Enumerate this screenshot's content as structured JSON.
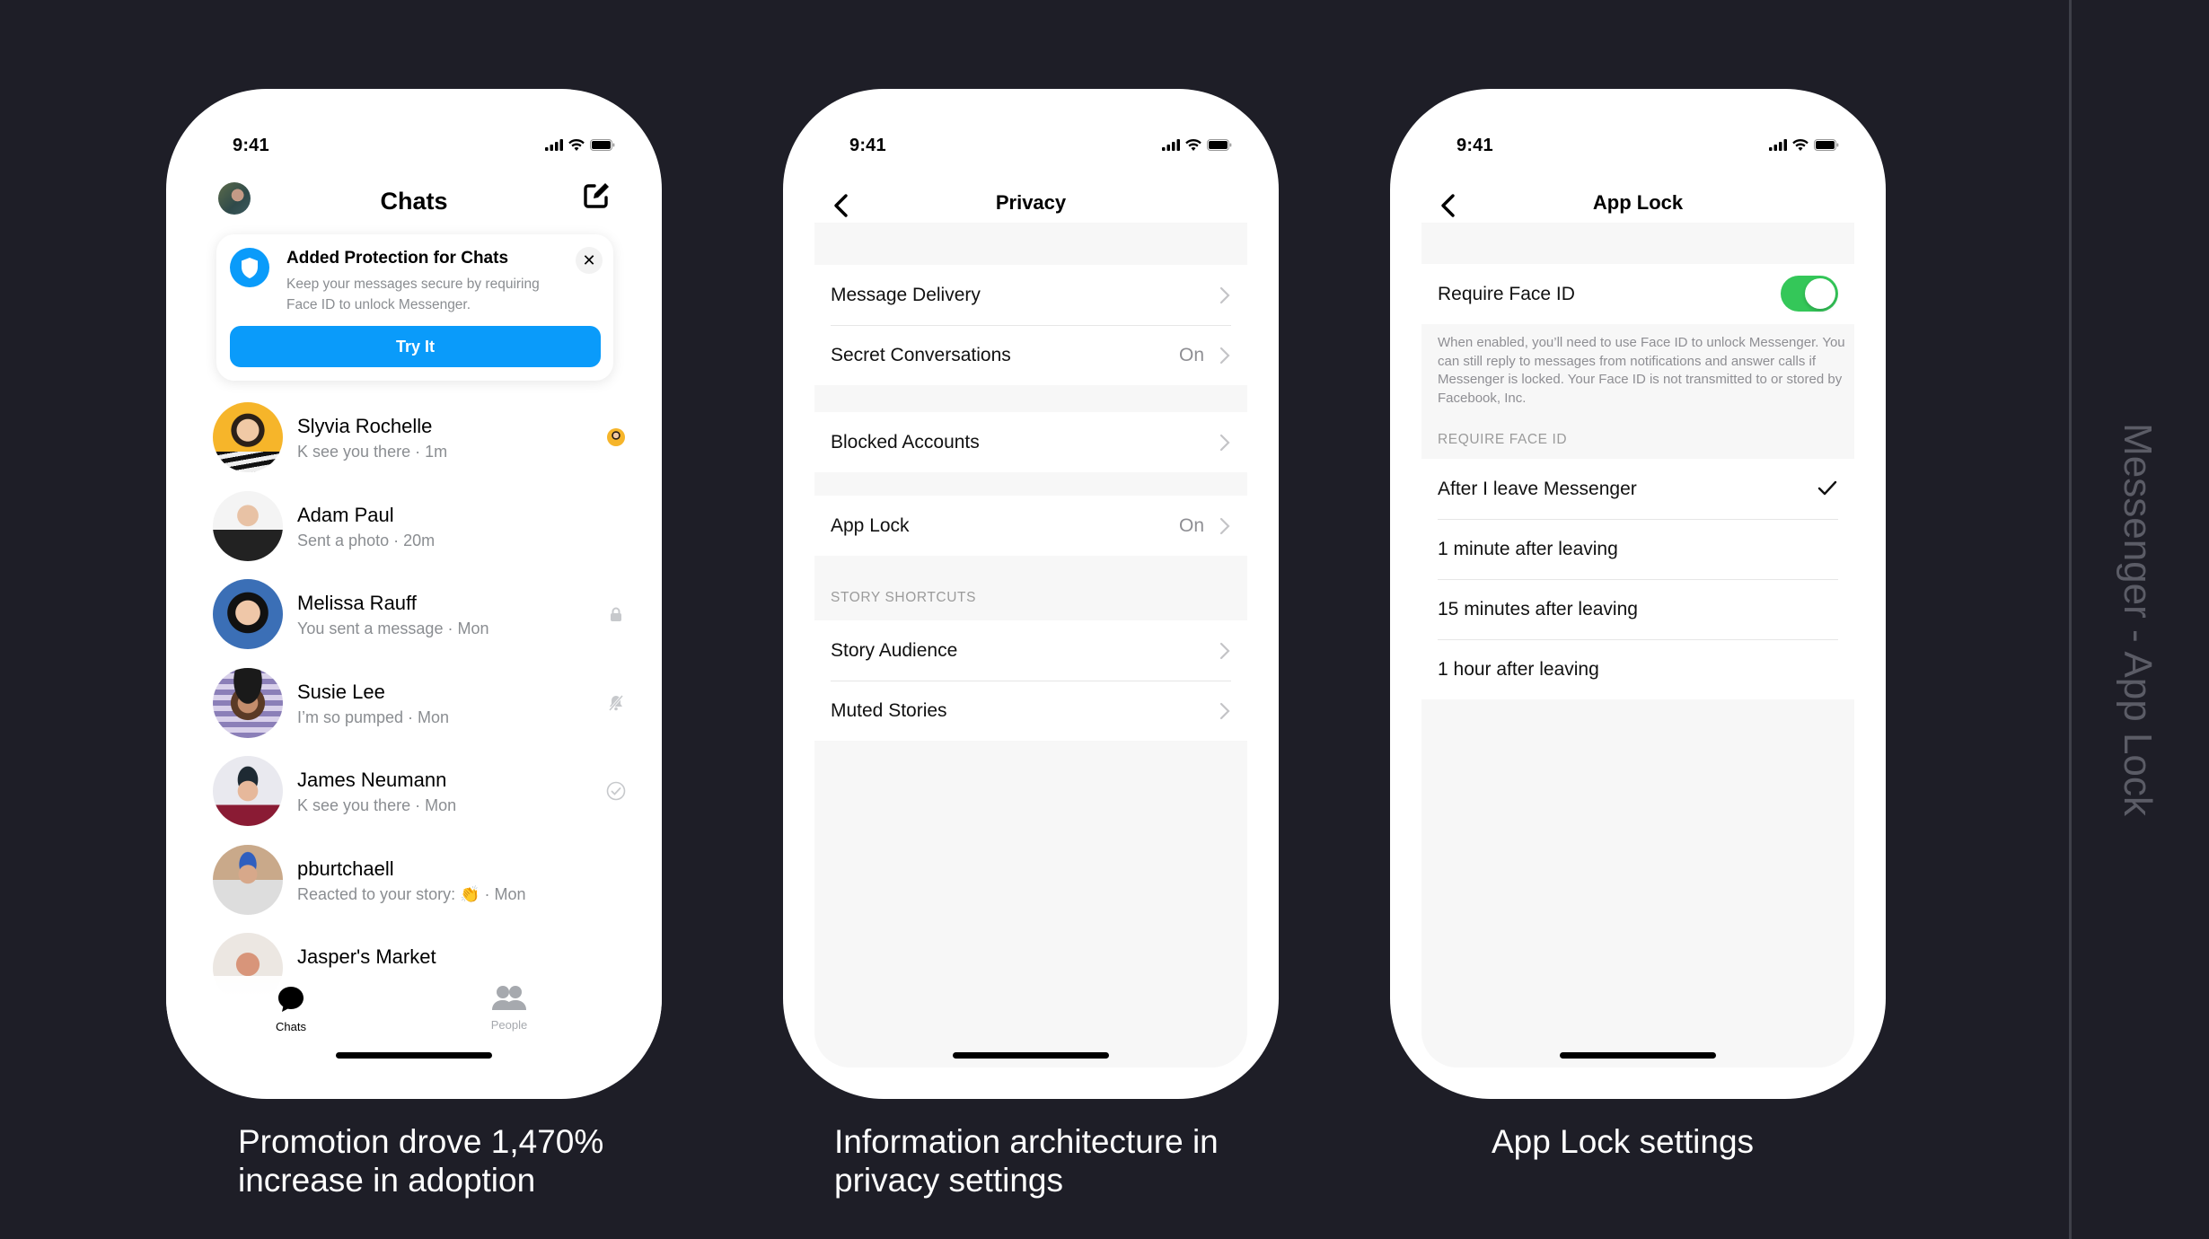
{
  "side_title": "Messenger - App Lock",
  "captions": [
    "Promotion drove 1,470% increase in adoption",
    "Information architecture in privacy settings",
    "App Lock settings"
  ],
  "status_bar": {
    "time": "9:41"
  },
  "chats_screen": {
    "title": "Chats",
    "promo": {
      "title": "Added Protection for Chats",
      "body": "Keep your messages secure by requiring Face ID to unlock Messenger.",
      "button": "Try It",
      "close": "✕"
    },
    "chats": [
      {
        "name": "Slyvia Rochelle",
        "preview": "K see you there · 1m",
        "status": "seen-avatar"
      },
      {
        "name": "Adam Paul",
        "preview": "Sent a photo · 20m",
        "status": "none"
      },
      {
        "name": "Melissa Rauff",
        "preview": "You sent a message · Mon",
        "status": "lock"
      },
      {
        "name": "Susie Lee",
        "preview": "I’m so pumped · Mon",
        "status": "muted"
      },
      {
        "name": "James Neumann",
        "preview": "K see you there · Mon",
        "status": "delivered"
      },
      {
        "name": "pburtchaell",
        "preview": "Reacted to your story: 👏 · Mon",
        "status": "none"
      },
      {
        "name": "Jasper's Market",
        "preview": "",
        "status": "none"
      }
    ],
    "tabs": [
      {
        "label": "Chats",
        "active": true
      },
      {
        "label": "People",
        "active": false
      }
    ]
  },
  "privacy_screen": {
    "title": "Privacy",
    "groups": [
      {
        "rows": [
          {
            "label": "Message Delivery",
            "value": ""
          },
          {
            "label": "Secret Conversations",
            "value": "On"
          }
        ]
      },
      {
        "rows": [
          {
            "label": "Blocked Accounts",
            "value": ""
          }
        ]
      },
      {
        "rows": [
          {
            "label": "App Lock",
            "value": "On"
          }
        ]
      },
      {
        "header": "STORY SHORTCUTS",
        "rows": [
          {
            "label": "Story Audience",
            "value": ""
          },
          {
            "label": "Muted Stories",
            "value": ""
          }
        ]
      }
    ]
  },
  "applock_screen": {
    "title": "App Lock",
    "require_face_id": {
      "label": "Require Face ID",
      "enabled": true
    },
    "footnote": "When enabled, you’ll need to use Face ID to unlock Messenger. You can still reply to messages from notifications and answer calls if Messenger is locked. Your Face ID is not transmitted to or stored by Facebook, Inc.",
    "section_header": "REQUIRE FACE ID",
    "options": [
      {
        "label": "After I leave Messenger",
        "selected": true
      },
      {
        "label": "1 minute after leaving",
        "selected": false
      },
      {
        "label": "15 minutes after leaving",
        "selected": false
      },
      {
        "label": "1 hour after leaving",
        "selected": false
      }
    ]
  },
  "colors": {
    "background": "#1e1e27",
    "messenger_blue": "#0a9bfa",
    "toggle_green": "#34c759",
    "secondary_text": "#8a8d91"
  }
}
